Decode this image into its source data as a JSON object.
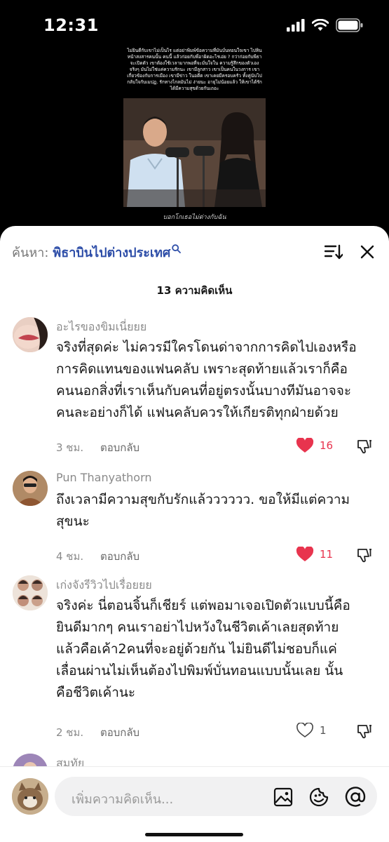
{
  "status_bar": {
    "time": "12:31"
  },
  "video": {
    "caption": "ไม่ยินดีกับเขาไม่เป็นไร แต่อย่าพิมพ์ข้อความที่มันบั่นทอนใจเขา ไปหินหน้าสงสารคนนั้น คนนี้ แล้วก่อยกับพี่อาผิดอะไรเอ่ย ? กว่าก่อยกับพีธาจะเปิดตัว เขาต้องใช้เวลามากพอที่จะมั่นใจใน ความรู้สึกของตัวเองจริงๆ มันไม่ใช่แค่ความรักนะ เขามีลูกสาว เขาเป็นคนในวงการ เขาเกี่ยวข้องกับการเมือง เขามีข่าว ในอดีต เขาเคยมีครอบครัว ทั้งคู่นับไปกลับใจกับเมปฏ. รักทางไกลมันไม่ ง่ายนะ อายุไม่น้อยแล้ว ให้เขาได้รักได้มีความสุขด้วยกันเถอะ",
    "subtitle": "บอกโกเธอไม่ต่างกับฉัน"
  },
  "search": {
    "prefix": "ค้นหา:",
    "term": "พิธาบินไปต่างประเทศ"
  },
  "comments_count_title": "13 ความคิดเห็น",
  "comments": [
    {
      "author": "อะไรของขิมเนี่ยยย",
      "lines": [
        "จริงที่สุดค่ะ ไม่ควรมีใครโดนด่าจากการคิดไปเองหรือ",
        "การคิดแทนของแฟนคลับ เพราะสุดท้ายแล้วเราก็คือ",
        "คนนอกสิ่งที่เราเห็นกับคนที่อยู่ตรงนั้นบางทีมันอาจจะ",
        "คนละอย่างก็ได้ แฟนคลับควรให้เกียรติทุกฝ่ายด้วย"
      ],
      "time": "3 ชม.",
      "reply": "ตอบกลับ",
      "likes": "16",
      "liked": true
    },
    {
      "author": "Pun Thanyathorn",
      "lines": [
        "ถึงเวลามีความสุขกับรักแล้วววววว. ขอให้มีแต่ความ",
        "สุขนะ"
      ],
      "time": "4 ชม.",
      "reply": "ตอบกลับ",
      "likes": "11",
      "liked": true
    },
    {
      "author": "เก่งจังรีวิวไปเรื่อยยย",
      "lines": [
        "จริงค่ะ นี่ตอนจิ้นก็เชียร์ แต่พอมาเจอเปิดตัวแบบนี้คือ",
        "ยินดีมากๆ คนเราอย่าไปหวังในชีวิตเค้าเลยสุดท้าย",
        "แล้วคือเค้า2คนที่จะอยู่ด้วยกัน ไม่ยินดีไม่ชอบก็แค่",
        "เลื่อนผ่านไม่เห็นต้องไปพิมพ์บั่นทอนแบบนั้นเลย นั้น",
        "คือชีวิตเค้านะ"
      ],
      "time": "2 ชม.",
      "reply": "ตอบกลับ",
      "likes": "1",
      "liked": false
    },
    {
      "author": "สมทัย",
      "lines": [],
      "time": "",
      "reply": "",
      "likes": "",
      "liked": false
    }
  ],
  "composer": {
    "placeholder": "เพิ่มความคิดเห็น..."
  },
  "colors": {
    "like_red": "#e8344e",
    "search_blue": "#2e4ea8",
    "meta_gray": "#8a8a8a"
  },
  "icons": [
    "signal-icon",
    "wifi-icon",
    "battery-icon",
    "search-icon",
    "sort-icon",
    "close-icon",
    "heart-icon",
    "dislike-icon",
    "image-icon",
    "emoji-icon",
    "mention-icon"
  ]
}
